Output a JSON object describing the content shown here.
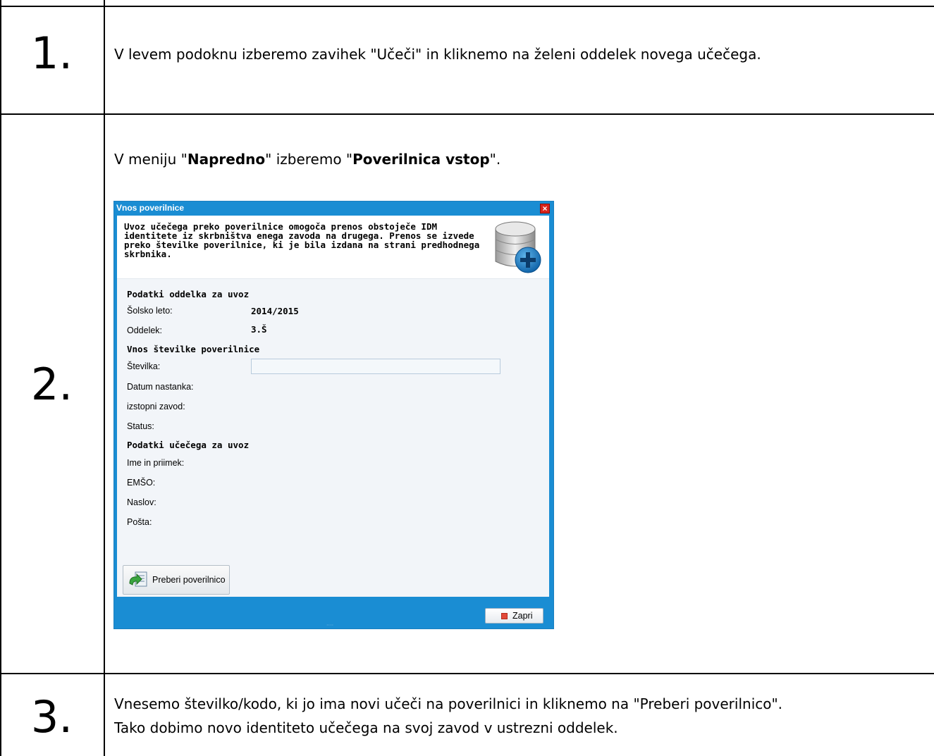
{
  "steps": [
    {
      "number": "1.",
      "text": "V levem podoknu izberemo zavihek \"Učeči\" in kliknemo na želeni oddelek novega učečega."
    },
    {
      "number": "2.",
      "text_parts": [
        "V meniju \"",
        "Napredno",
        "\" izberemo \"",
        "Poverilnica vstop",
        "\"."
      ]
    },
    {
      "number": "3.",
      "text_lines": [
        "Vnesemo številko/kodo, ki jo ima novi učeči na poverilnici in kliknemo na \"Preberi poverilnico\".",
        "Tako dobimo novo identiteto učečega na svoj zavod v ustrezni oddelek."
      ]
    }
  ],
  "dialog": {
    "title": "Vnos poverilnice",
    "close_glyph": "×",
    "intro_lines": [
      "Uvoz učečega preko poverilnice omogoča prenos obstoječe IDM",
      "identitete iz skrbništva enega zavoda na drugega. Prenos se izvede",
      "preko številke poverilnice, ki je bila izdana na strani predhodnega",
      "skrbnika."
    ],
    "section_dept": "Podatki oddelka za uvoz",
    "school_year_label": "Šolsko leto:",
    "school_year_value": "2014/2015",
    "dept_label": "Oddelek:",
    "dept_value": "3.Š",
    "section_credential": "Vnos številke poverilnice",
    "number_label": "Številka:",
    "number_value": "",
    "created_label": "Datum nastanka:",
    "exit_institution_label": "izstopni zavod:",
    "status_label": "Status:",
    "section_learner": "Podatki učečega za uvoz",
    "name_label": "Ime in priimek:",
    "emso_label": "EMŠO:",
    "address_label": "Naslov:",
    "post_label": "Pošta:",
    "read_button": "Preberi poverilnico",
    "close_button": "Zapri"
  },
  "colors": {
    "dialog_frame": "#1a8dd3",
    "dialog_body": "#f2f5f9",
    "close_red": "#d9241b"
  },
  "icons": {
    "dialog_close": "close-icon",
    "header": "database-add-icon",
    "read_button": "credential-read-icon",
    "close_button": "stop-square-icon"
  }
}
